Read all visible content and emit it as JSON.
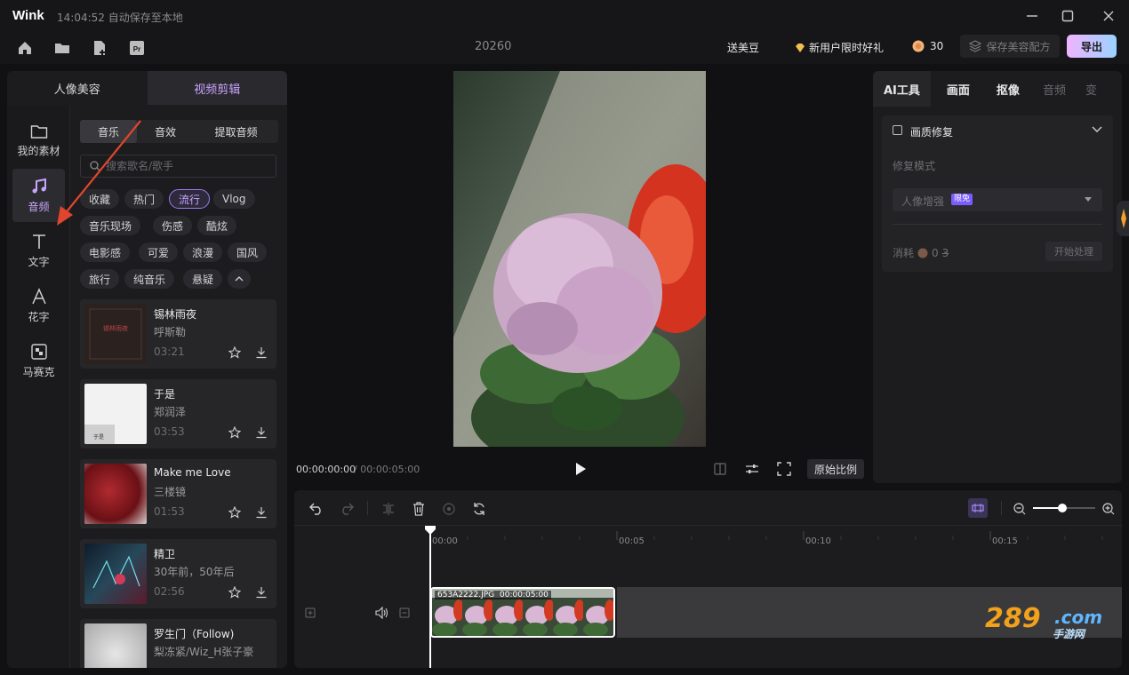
{
  "app": {
    "name": "Wink",
    "save_status": "14:04:52 自动保存至本地"
  },
  "toolbar": {
    "project_name": "20260",
    "gift_beans": "送美豆",
    "new_user_gift": "新用户限时好礼",
    "coins": "30",
    "save_config": "保存美容配方",
    "export": "导出"
  },
  "left_tabs": [
    "人像美容",
    "视频剪辑"
  ],
  "nav": [
    {
      "label": "我的素材",
      "icon": "folder-icon"
    },
    {
      "label": "音频",
      "icon": "music-note-icon"
    },
    {
      "label": "文字",
      "icon": "text-icon"
    },
    {
      "label": "花字",
      "icon": "fancy-text-icon"
    },
    {
      "label": "马赛克",
      "icon": "mosaic-icon"
    }
  ],
  "audio_tabs": [
    "音乐",
    "音效",
    "提取音频"
  ],
  "search": {
    "placeholder": "搜索歌名/歌手"
  },
  "tags": [
    "收藏",
    "热门",
    "流行",
    "Vlog",
    "音乐现场",
    "伤感",
    "酷炫",
    "电影感",
    "可爱",
    "浪漫",
    "国风",
    "旅行",
    "纯音乐",
    "悬疑"
  ],
  "songs": [
    {
      "title": "锡林雨夜",
      "artist": "呼斯勒",
      "duration": "03:21",
      "cover_color": "#2b2220"
    },
    {
      "title": "于是",
      "artist": "郑润泽",
      "duration": "03:53",
      "cover_color": "#f2f2f2"
    },
    {
      "title": "Make me Love",
      "artist": "三楼镜",
      "duration": "01:53",
      "cover_color": "#8a1a20"
    },
    {
      "title": "精卫",
      "artist": "30年前，50年后",
      "duration": "02:56",
      "cover_color": "#1a2a35"
    },
    {
      "title": "罗生门（Follow)",
      "artist": "梨冻紧/Wiz_H张子豪",
      "duration": "",
      "cover_color": "#c9c9c9"
    }
  ],
  "player": {
    "current_time": "00:00:00:00",
    "total_time": "/ 00:00:05:00",
    "ratio_button": "原始比例"
  },
  "right_tabs": [
    "AI工具",
    "画面",
    "抠像",
    "音频",
    "变"
  ],
  "ai_card": {
    "title": "画质修复",
    "mode_label": "修复模式",
    "mode_value": "人像增强",
    "mode_badge": "限免",
    "cost_label": "消耗",
    "cost_value": "0",
    "cost_old": "3",
    "start_button": "开始处理"
  },
  "timeline": {
    "ticks": [
      "00:00",
      "00:05",
      "00:10",
      "00:15"
    ],
    "clip_name": "653A2222.JPG",
    "clip_duration": "00:00:05:00"
  },
  "watermark": {
    "brand": "289.com",
    "sub": "手游网"
  }
}
